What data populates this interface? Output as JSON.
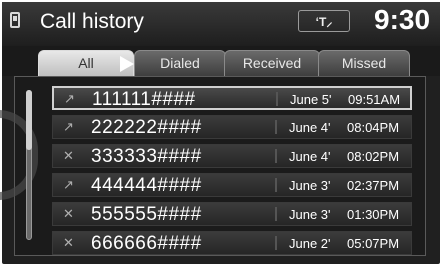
{
  "header": {
    "title": "Call history",
    "status": "ʻT⸝",
    "clock": "9:30"
  },
  "tabs": [
    {
      "label": "All"
    },
    {
      "label": "Dialed"
    },
    {
      "label": "Received"
    },
    {
      "label": "Missed"
    }
  ],
  "rows": [
    {
      "icon": "outgoing-call-icon",
      "glyph": "↗",
      "number": "111111####",
      "date": "June 5'",
      "time": "09:51AM"
    },
    {
      "icon": "outgoing-call-icon",
      "glyph": "↗",
      "number": "222222####",
      "date": "June 4'",
      "time": "08:04PM"
    },
    {
      "icon": "missed-call-icon",
      "glyph": "✕",
      "number": "333333####",
      "date": "June 4'",
      "time": "08:02PM"
    },
    {
      "icon": "outgoing-call-icon",
      "glyph": "↗",
      "number": "444444####",
      "date": "June 3'",
      "time": "02:37PM"
    },
    {
      "icon": "missed-call-icon",
      "glyph": "✕",
      "number": "555555####",
      "date": "June 3'",
      "time": "01:30PM"
    },
    {
      "icon": "missed-call-icon",
      "glyph": "✕",
      "number": "666666####",
      "date": "June 2'",
      "time": "05:07PM"
    }
  ]
}
